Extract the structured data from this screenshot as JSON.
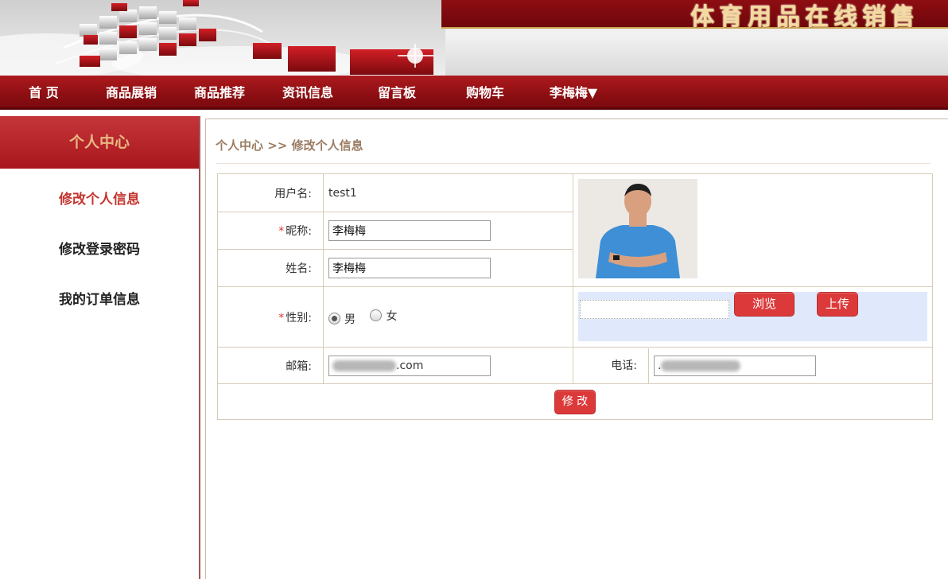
{
  "site": {
    "title": "体育用品在线销售"
  },
  "nav": {
    "items": [
      {
        "label": "首 页"
      },
      {
        "label": "商品展销"
      },
      {
        "label": "商品推荐"
      },
      {
        "label": "资讯信息"
      },
      {
        "label": "留言板"
      },
      {
        "label": "购物车"
      },
      {
        "label": "李梅梅▼"
      }
    ]
  },
  "sidebar": {
    "heading": "个人中心",
    "items": [
      {
        "label": "修改个人信息",
        "active": true
      },
      {
        "label": "修改登录密码",
        "active": false
      },
      {
        "label": "我的订单信息",
        "active": false
      }
    ]
  },
  "breadcrumb": "个人中心 >> 修改个人信息",
  "form": {
    "username_label": "用户名:",
    "username_value": "test1",
    "required_mark": "*",
    "nickname_label": "昵称:",
    "nickname_value": "李梅梅",
    "realname_label": "姓名:",
    "realname_value": "李梅梅",
    "gender_label": "性别:",
    "gender_male": "男",
    "gender_female": "女",
    "gender_selected": "男",
    "email_label": "邮箱:",
    "email_visible": ".com",
    "phone_label": "电话:",
    "phone_visible": ".",
    "browse_button": "浏览",
    "upload_button": "上传",
    "submit_button": "修 改"
  },
  "colors": {
    "brand_red": "#8d0f13",
    "button_red": "#dc3a3a",
    "active_link": "#c4352f",
    "breadcrumb": "#9b7c62",
    "upload_bg": "#dfe9fb"
  }
}
